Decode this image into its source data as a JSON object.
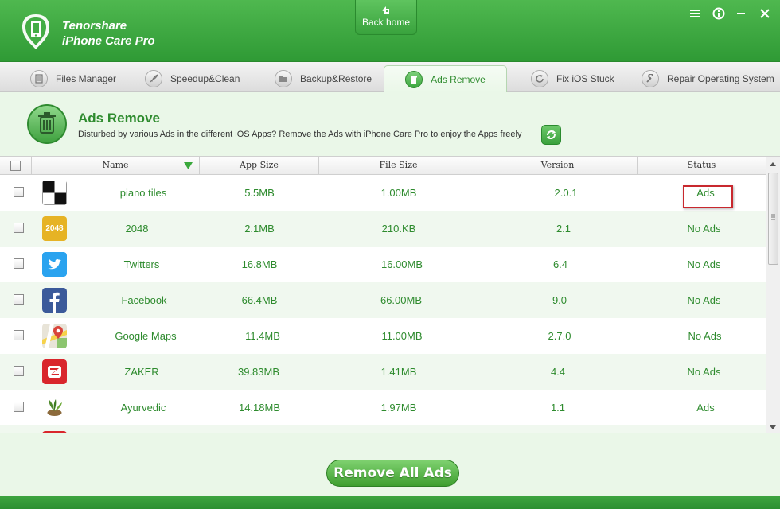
{
  "app": {
    "brand_line1": "Tenorshare",
    "brand_line2": "iPhone Care Pro",
    "back_home": "Back home"
  },
  "colors": {
    "accent": "#2e8b2e",
    "header_green": "#3aa83c",
    "highlight": "#c8282e"
  },
  "tabs": [
    {
      "label": "Files Manager",
      "icon": "files-icon"
    },
    {
      "label": "Speedup&Clean",
      "icon": "rocket-icon"
    },
    {
      "label": "Backup&Restore",
      "icon": "folder-icon"
    },
    {
      "label": "Ads Remove",
      "icon": "trash-icon",
      "active": true
    },
    {
      "label": "Fix iOS Stuck",
      "icon": "refresh-icon"
    },
    {
      "label": "Repair Operating System",
      "icon": "wrench-icon"
    }
  ],
  "section": {
    "title": "Ads Remove",
    "description": "Disturbed by various Ads in the different iOS Apps? Remove the Ads with iPhone Care Pro to enjoy the Apps freely"
  },
  "table": {
    "columns": [
      "Name",
      "App Size",
      "File Size",
      "Version",
      "Status"
    ],
    "rows": [
      {
        "name": "piano tiles",
        "app_size": "5.5MB",
        "file_size": "1.00MB",
        "version": "2.0.1",
        "status": "Ads",
        "icon": "piano-tiles-icon"
      },
      {
        "name": "2048",
        "app_size": "2.1MB",
        "file_size": "210.KB",
        "version": "2.1",
        "status": "No Ads",
        "icon": "game-2048-icon",
        "icon_text": "2048"
      },
      {
        "name": "Twitters",
        "app_size": "16.8MB",
        "file_size": "16.00MB",
        "version": "6.4",
        "status": "No Ads",
        "icon": "twitter-icon"
      },
      {
        "name": "Facebook",
        "app_size": "66.4MB",
        "file_size": "66.00MB",
        "version": "9.0",
        "status": "No Ads",
        "icon": "facebook-icon"
      },
      {
        "name": "Google Maps",
        "app_size": "11.4MB",
        "file_size": "11.00MB",
        "version": "2.7.0",
        "status": "No Ads",
        "icon": "google-maps-icon"
      },
      {
        "name": "ZAKER",
        "app_size": "39.83MB",
        "file_size": "1.41MB",
        "version": "4.4",
        "status": "No Ads",
        "icon": "zaker-icon"
      },
      {
        "name": "Ayurvedic",
        "app_size": "14.18MB",
        "file_size": "1.97MB",
        "version": "1.1",
        "status": "Ads",
        "icon": "ayurvedic-icon"
      }
    ]
  },
  "actions": {
    "remove_all": "Remove All Ads"
  }
}
